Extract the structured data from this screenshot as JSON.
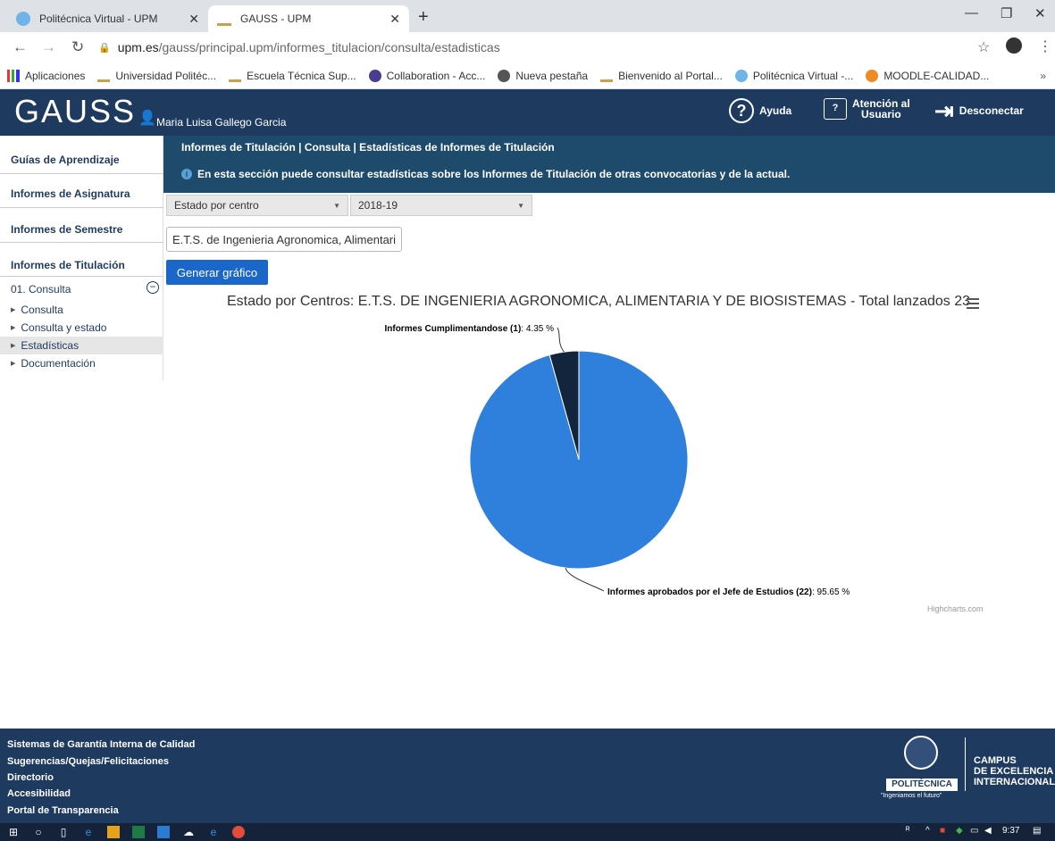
{
  "browser": {
    "tabs": [
      {
        "title": "Politécnica Virtual - UPM",
        "active": false
      },
      {
        "title": "GAUSS - UPM",
        "active": true
      }
    ],
    "new_tab": "+",
    "url_host": "upm.es",
    "url_path": "/gauss/principal.upm/informes_titulacion/consulta/estadisticas",
    "bookmarks": [
      "Aplicaciones",
      "Universidad Politéc...",
      "Escuela Técnica Sup...",
      "Collaboration - Acc...",
      "Nueva pestaña",
      "Bienvenido al Portal...",
      "Politécnica Virtual -...",
      "MOODLE-CALIDAD..."
    ],
    "bookmarks_more": "»"
  },
  "header": {
    "logo": "GAUSS",
    "user": "Maria Luisa Gallego Garcia",
    "help": "Ayuda",
    "support_line1": "Atención al",
    "support_line2": "Usuario",
    "logout": "Desconectar"
  },
  "sidebar": {
    "sections": [
      "Guías de Aprendizaje",
      "Informes de Asignatura",
      "Informes de Semestre",
      "Informes de Titulación"
    ],
    "group": "01. Consulta",
    "subitems": [
      "Consulta",
      "Consulta y estado",
      "Estadísticas",
      "Documentación"
    ],
    "selected": "Estadísticas"
  },
  "content": {
    "breadcrumb": "Informes de Titulación | Consulta | Estadísticas de Informes de Titulación",
    "info": "En esta sección puede consultar estadísticas sobre los Informes de Titulación de otras convocatorias y de la actual.",
    "select_type": "Estado por centro",
    "select_year": "2018-19",
    "centro": "E.T.S. de Ingenieria Agronomica, Alimentari",
    "generate_button": "Generar gráfico",
    "credits": "Highcharts.com"
  },
  "chart_data": {
    "type": "pie",
    "title": "Estado por Centros: E.T.S. DE INGENIERIA AGRONOMICA, ALIMENTARIA Y DE BIOSISTEMAS - Total lanzados 23",
    "slices": [
      {
        "name": "Informes aprobados por el Jefe de Estudios",
        "count": 22,
        "percent": 95.65,
        "color": "#2f80dc",
        "label": "Informes aprobados por el Jefe de Estudios (22)",
        "pct_label": ": 95.65 %"
      },
      {
        "name": "Informes Cumplimentandose",
        "count": 1,
        "percent": 4.35,
        "color": "#13243d",
        "label": "Informes Cumplimentandose (1)",
        "pct_label": ": 4.35 %"
      }
    ]
  },
  "footer": {
    "links": [
      "Sistemas de Garantía Interna de Calidad",
      "Sugerencias/Quejas/Felicitaciones",
      "Directorio",
      "Accesibilidad",
      "Portal de Transparencia"
    ],
    "upm": "POLITÉCNICA",
    "motto": "\"Ingeniamos el futuro\"",
    "campus": [
      "CAMPUS",
      "DE EXCELENCIA",
      "INTERNACIONAL"
    ]
  },
  "taskbar": {
    "time": "9:37"
  },
  "colors": {
    "header_bg": "#1e3a5f",
    "band_bg": "#1e4a6b",
    "button_bg": "#1a66c9"
  }
}
